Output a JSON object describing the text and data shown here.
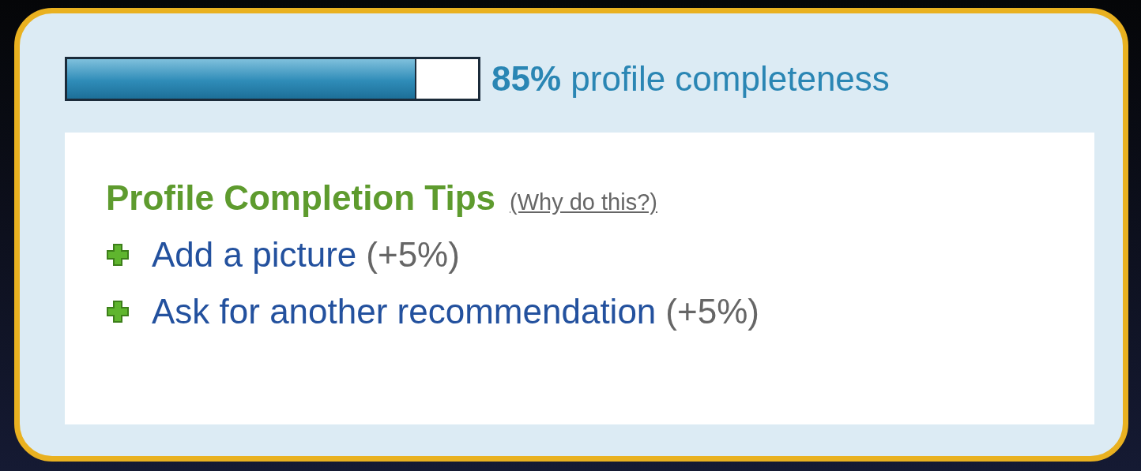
{
  "progress": {
    "level": 0.85,
    "label": "**85%** profile completeness"
  },
  "tips": {
    "title": "Profile Completion Tips",
    "help_link": "(Why do this?)",
    "items": [
      {
        "label": "Add a picture",
        "bonus": "(+5%)"
      },
      {
        "label": "Ask for another recommendation",
        "bonus": "(+5%)"
      }
    ]
  }
}
